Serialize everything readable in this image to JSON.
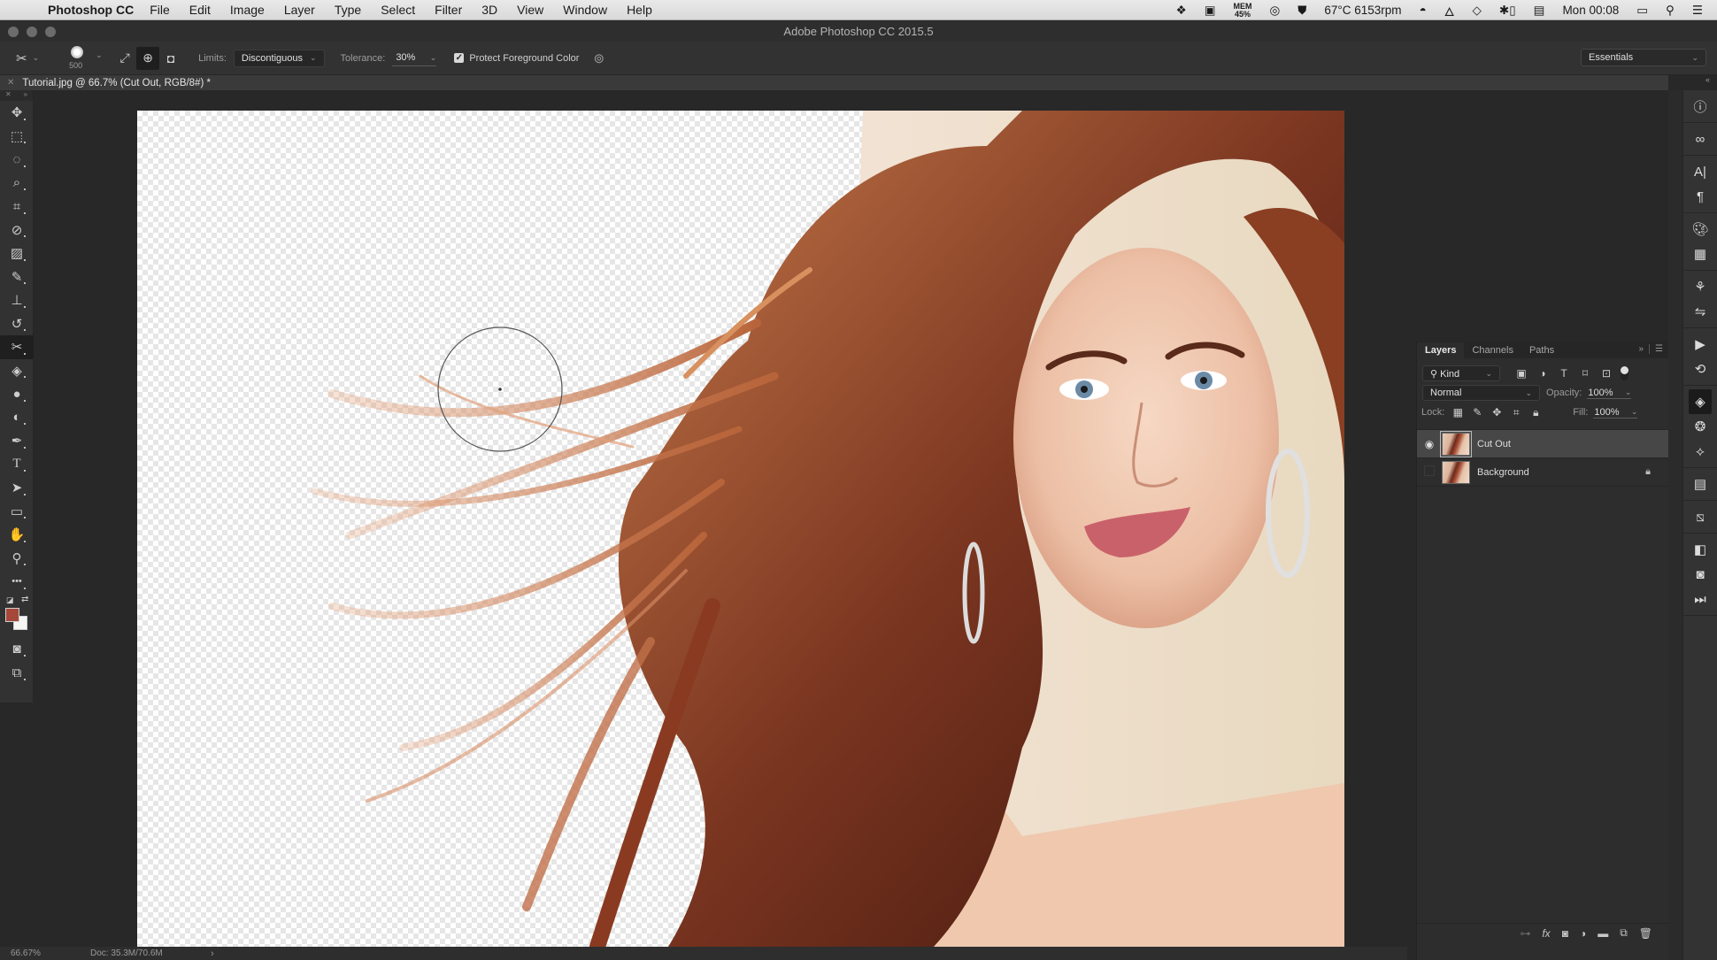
{
  "menubar": {
    "app_name": "Photoshop CC",
    "items": [
      "File",
      "Edit",
      "Image",
      "Layer",
      "Type",
      "Select",
      "Filter",
      "3D",
      "View",
      "Window",
      "Help"
    ],
    "status": {
      "mem_label": "MEM",
      "mem_value": "45%",
      "temp_fan": "67°C 6153rpm",
      "clock": "Mon 00:08"
    }
  },
  "window": {
    "title": "Adobe Photoshop CC 2015.5"
  },
  "options_bar": {
    "brush_size": "500",
    "limits_label": "Limits:",
    "limits_value": "Discontiguous",
    "tolerance_label": "Tolerance:",
    "tolerance_value": "30%",
    "protect_fg_label": "Protect Foreground Color",
    "protect_fg_checked": true,
    "workspace": "Essentials"
  },
  "document": {
    "tab_label": "Tutorial.jpg @ 66.7% (Cut Out, RGB/8#) *"
  },
  "tools": [
    {
      "name": "move-tool",
      "glyph": "✥"
    },
    {
      "name": "marquee-tool",
      "glyph": "⬚"
    },
    {
      "name": "lasso-tool",
      "glyph": "◌"
    },
    {
      "name": "quick-selection-tool",
      "glyph": "⌕"
    },
    {
      "name": "crop-tool",
      "glyph": "⌗"
    },
    {
      "name": "eyedropper-tool",
      "glyph": "⊘"
    },
    {
      "name": "healing-brush-tool",
      "glyph": "▨"
    },
    {
      "name": "brush-tool",
      "glyph": "✎"
    },
    {
      "name": "clone-stamp-tool",
      "glyph": "⊥"
    },
    {
      "name": "history-brush-tool",
      "glyph": "↺"
    },
    {
      "name": "background-eraser-tool",
      "glyph": "✂",
      "active": true
    },
    {
      "name": "paint-bucket-tool",
      "glyph": "◈"
    },
    {
      "name": "blur-tool",
      "glyph": "●"
    },
    {
      "name": "dodge-tool",
      "glyph": "◐"
    },
    {
      "name": "pen-tool",
      "glyph": "✒"
    },
    {
      "name": "type-tool",
      "glyph": "T"
    },
    {
      "name": "path-selection-tool",
      "glyph": "➤"
    },
    {
      "name": "rectangle-tool",
      "glyph": "▭"
    },
    {
      "name": "hand-tool",
      "glyph": "✋"
    },
    {
      "name": "zoom-tool",
      "glyph": "⚲"
    },
    {
      "name": "edit-toolbar",
      "glyph": "•••"
    }
  ],
  "colors": {
    "foreground": "#a5483a",
    "background": "#f5f5f2"
  },
  "status_bar": {
    "zoom": "66.67%",
    "doc_size": "Doc: 35.3M/70.6M",
    "arrow": "›"
  },
  "layers_panel": {
    "tabs": [
      {
        "label": "Layers",
        "active": true
      },
      {
        "label": "Channels",
        "active": false
      },
      {
        "label": "Paths",
        "active": false
      }
    ],
    "filter_kind": "Kind",
    "blend_mode": "Normal",
    "opacity_label": "Opacity:",
    "opacity_value": "100%",
    "lock_label": "Lock:",
    "fill_label": "Fill:",
    "fill_value": "100%",
    "layers": [
      {
        "name": "Cut Out",
        "visible": true,
        "selected": true,
        "locked": false
      },
      {
        "name": "Background",
        "visible": false,
        "selected": false,
        "locked": true
      }
    ]
  }
}
